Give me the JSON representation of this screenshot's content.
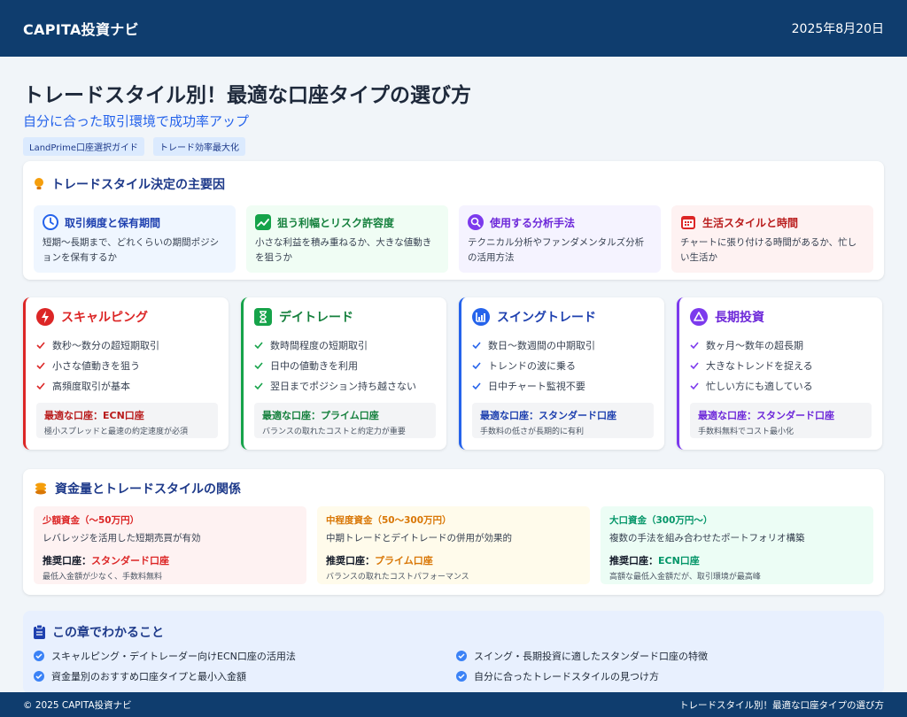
{
  "header": {
    "brand": "CAPITA投資ナビ",
    "date": "2025年8月20日"
  },
  "hero": {
    "title": "トレードスタイル別！最適な口座タイプの選び方",
    "subtitle": "自分に合った取引環境で成功率アップ",
    "tags": [
      "LandPrime口座選択ガイド",
      "トレード効率最大化"
    ]
  },
  "factors": {
    "heading": "トレードスタイル決定の主要因",
    "items": [
      {
        "title": "取引頻度と保有期間",
        "desc": "短期〜長期まで、どれくらいの期間ポジションを保有するか",
        "icon": "clock-icon",
        "color": "#2563eb",
        "bg": "#eff6ff"
      },
      {
        "title": "狙う利幅とリスク許容度",
        "desc": "小さな利益を積み重ねるか、大きな値動きを狙うか",
        "icon": "chart-line-icon",
        "color": "#16a34a",
        "bg": "#f0fdf4"
      },
      {
        "title": "使用する分析手法",
        "desc": "テクニカル分析やファンダメンタルズ分析の活用方法",
        "icon": "magnifier-icon",
        "color": "#7c3aed",
        "bg": "#f5f3ff"
      },
      {
        "title": "生活スタイルと時間",
        "desc": "チャートに張り付ける時間があるか、忙しい生活か",
        "icon": "calendar-icon",
        "color": "#dc2626",
        "bg": "#fef2f2"
      }
    ]
  },
  "styles": [
    {
      "title": "スキャルピング",
      "icon": "bolt-icon",
      "color": "#dc2626",
      "points": [
        "数秒〜数分の超短期取引",
        "小さな値動きを狙う",
        "高頻度取引が基本"
      ],
      "account": "最適な口座：ECN口座",
      "account_note": "極小スプレッドと最速の約定速度が必須"
    },
    {
      "title": "デイトレード",
      "icon": "hourglass-icon",
      "color": "#16a34a",
      "points": [
        "数時間程度の短期取引",
        "日中の値動きを利用",
        "翌日までポジション持ち越さない"
      ],
      "account": "最適な口座：プライム口座",
      "account_note": "バランスの取れたコストと約定力が重要"
    },
    {
      "title": "スイングトレード",
      "icon": "bar-chart-icon",
      "color": "#2563eb",
      "points": [
        "数日〜数週間の中期取引",
        "トレンドの波に乗る",
        "日中チャート監視不要"
      ],
      "account": "最適な口座：スタンダード口座",
      "account_note": "手数料の低さが長期的に有利"
    },
    {
      "title": "長期投資",
      "icon": "triangle-icon",
      "color": "#7c3aed",
      "points": [
        "数ヶ月〜数年の超長期",
        "大きなトレンドを捉える",
        "忙しい方にも適している"
      ],
      "account": "最適な口座：スタンダード口座",
      "account_note": "手数料無料でコスト最小化"
    }
  ],
  "capital": {
    "heading": "資金量とトレードスタイルの関係",
    "items": [
      {
        "range": "少額資金（〜50万円）",
        "desc": "レバレッジを活用した短期売買が有効",
        "rec_label": "推奨口座：",
        "rec_value": "スタンダード口座",
        "note": "最低入金額が少なく、手数料無料",
        "color": "#dc2626",
        "bg": "#fef2f2"
      },
      {
        "range": "中程度資金（50〜300万円）",
        "desc": "中期トレードとデイトレードの併用が効果的",
        "rec_label": "推奨口座：",
        "rec_value": "プライム口座",
        "note": "バランスの取れたコストパフォーマンス",
        "color": "#d97706",
        "bg": "#fffbeb"
      },
      {
        "range": "大口資金（300万円〜）",
        "desc": "複数の手法を組み合わせたポートフォリオ構築",
        "rec_label": "推奨口座：",
        "rec_value": "ECN口座",
        "note": "高額な最低入金額だが、取引環境が最高峰",
        "color": "#059669",
        "bg": "#ecfdf5"
      }
    ]
  },
  "learn": {
    "heading": "この章でわかること",
    "items": [
      "スキャルピング・デイトレーダー向けECN口座の活用法",
      "スイング・長期投資に適したスタンダード口座の特徴",
      "資金量別のおすすめ口座タイプと最小入金額",
      "自分に合ったトレードスタイルの見つけ方"
    ]
  },
  "footer": {
    "left": "© 2025 CAPITA投資ナビ",
    "right": "トレードスタイル別！最適な口座タイプの選び方"
  }
}
